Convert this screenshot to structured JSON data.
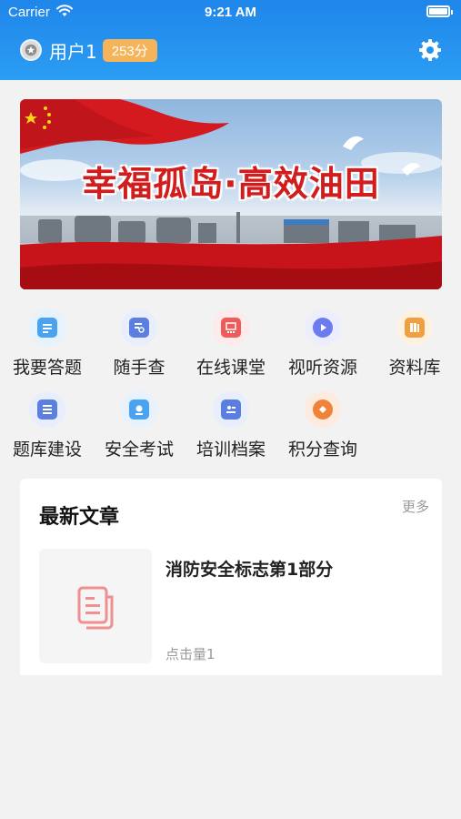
{
  "status_bar": {
    "carrier": "Carrier",
    "time": "9:21 AM"
  },
  "header": {
    "username": "用户1",
    "points": "253分",
    "settings_icon": "gear-icon",
    "avatar_icon": "star-icon"
  },
  "banner": {
    "title": "幸福孤岛·高效油田"
  },
  "menu": {
    "items": [
      {
        "label": "我要答题",
        "icon": "answer-icon",
        "color": "#4aa3f0",
        "bg": "#e6f2fd"
      },
      {
        "label": "随手查",
        "icon": "search-doc-icon",
        "color": "#5b7fe0",
        "bg": "#e8eefb"
      },
      {
        "label": "在线课堂",
        "icon": "classroom-icon",
        "color": "#ef5a5a",
        "bg": "#fdeaea"
      },
      {
        "label": "视听资源",
        "icon": "play-icon",
        "color": "#6c7cf0",
        "bg": "#ecedfd"
      },
      {
        "label": "资料库",
        "icon": "library-icon",
        "color": "#f0a040",
        "bg": "#fdf1e1"
      },
      {
        "label": "题库建设",
        "icon": "question-bank-icon",
        "color": "#5b7fe0",
        "bg": "#e8eefb"
      },
      {
        "label": "安全考试",
        "icon": "exam-icon",
        "color": "#4aa3f0",
        "bg": "#e6f2fd"
      },
      {
        "label": "培训档案",
        "icon": "archive-icon",
        "color": "#5b7fe0",
        "bg": "#e8eefb"
      },
      {
        "label": "积分查询",
        "icon": "points-icon",
        "color": "#f0823a",
        "bg": "#fdebe0"
      }
    ]
  },
  "articles": {
    "section_title": "最新文章",
    "more_label": "更多",
    "list": [
      {
        "title": "消防安全标志第1部分",
        "hits": "点击量1",
        "thumb_icon": "document-icon"
      }
    ]
  }
}
